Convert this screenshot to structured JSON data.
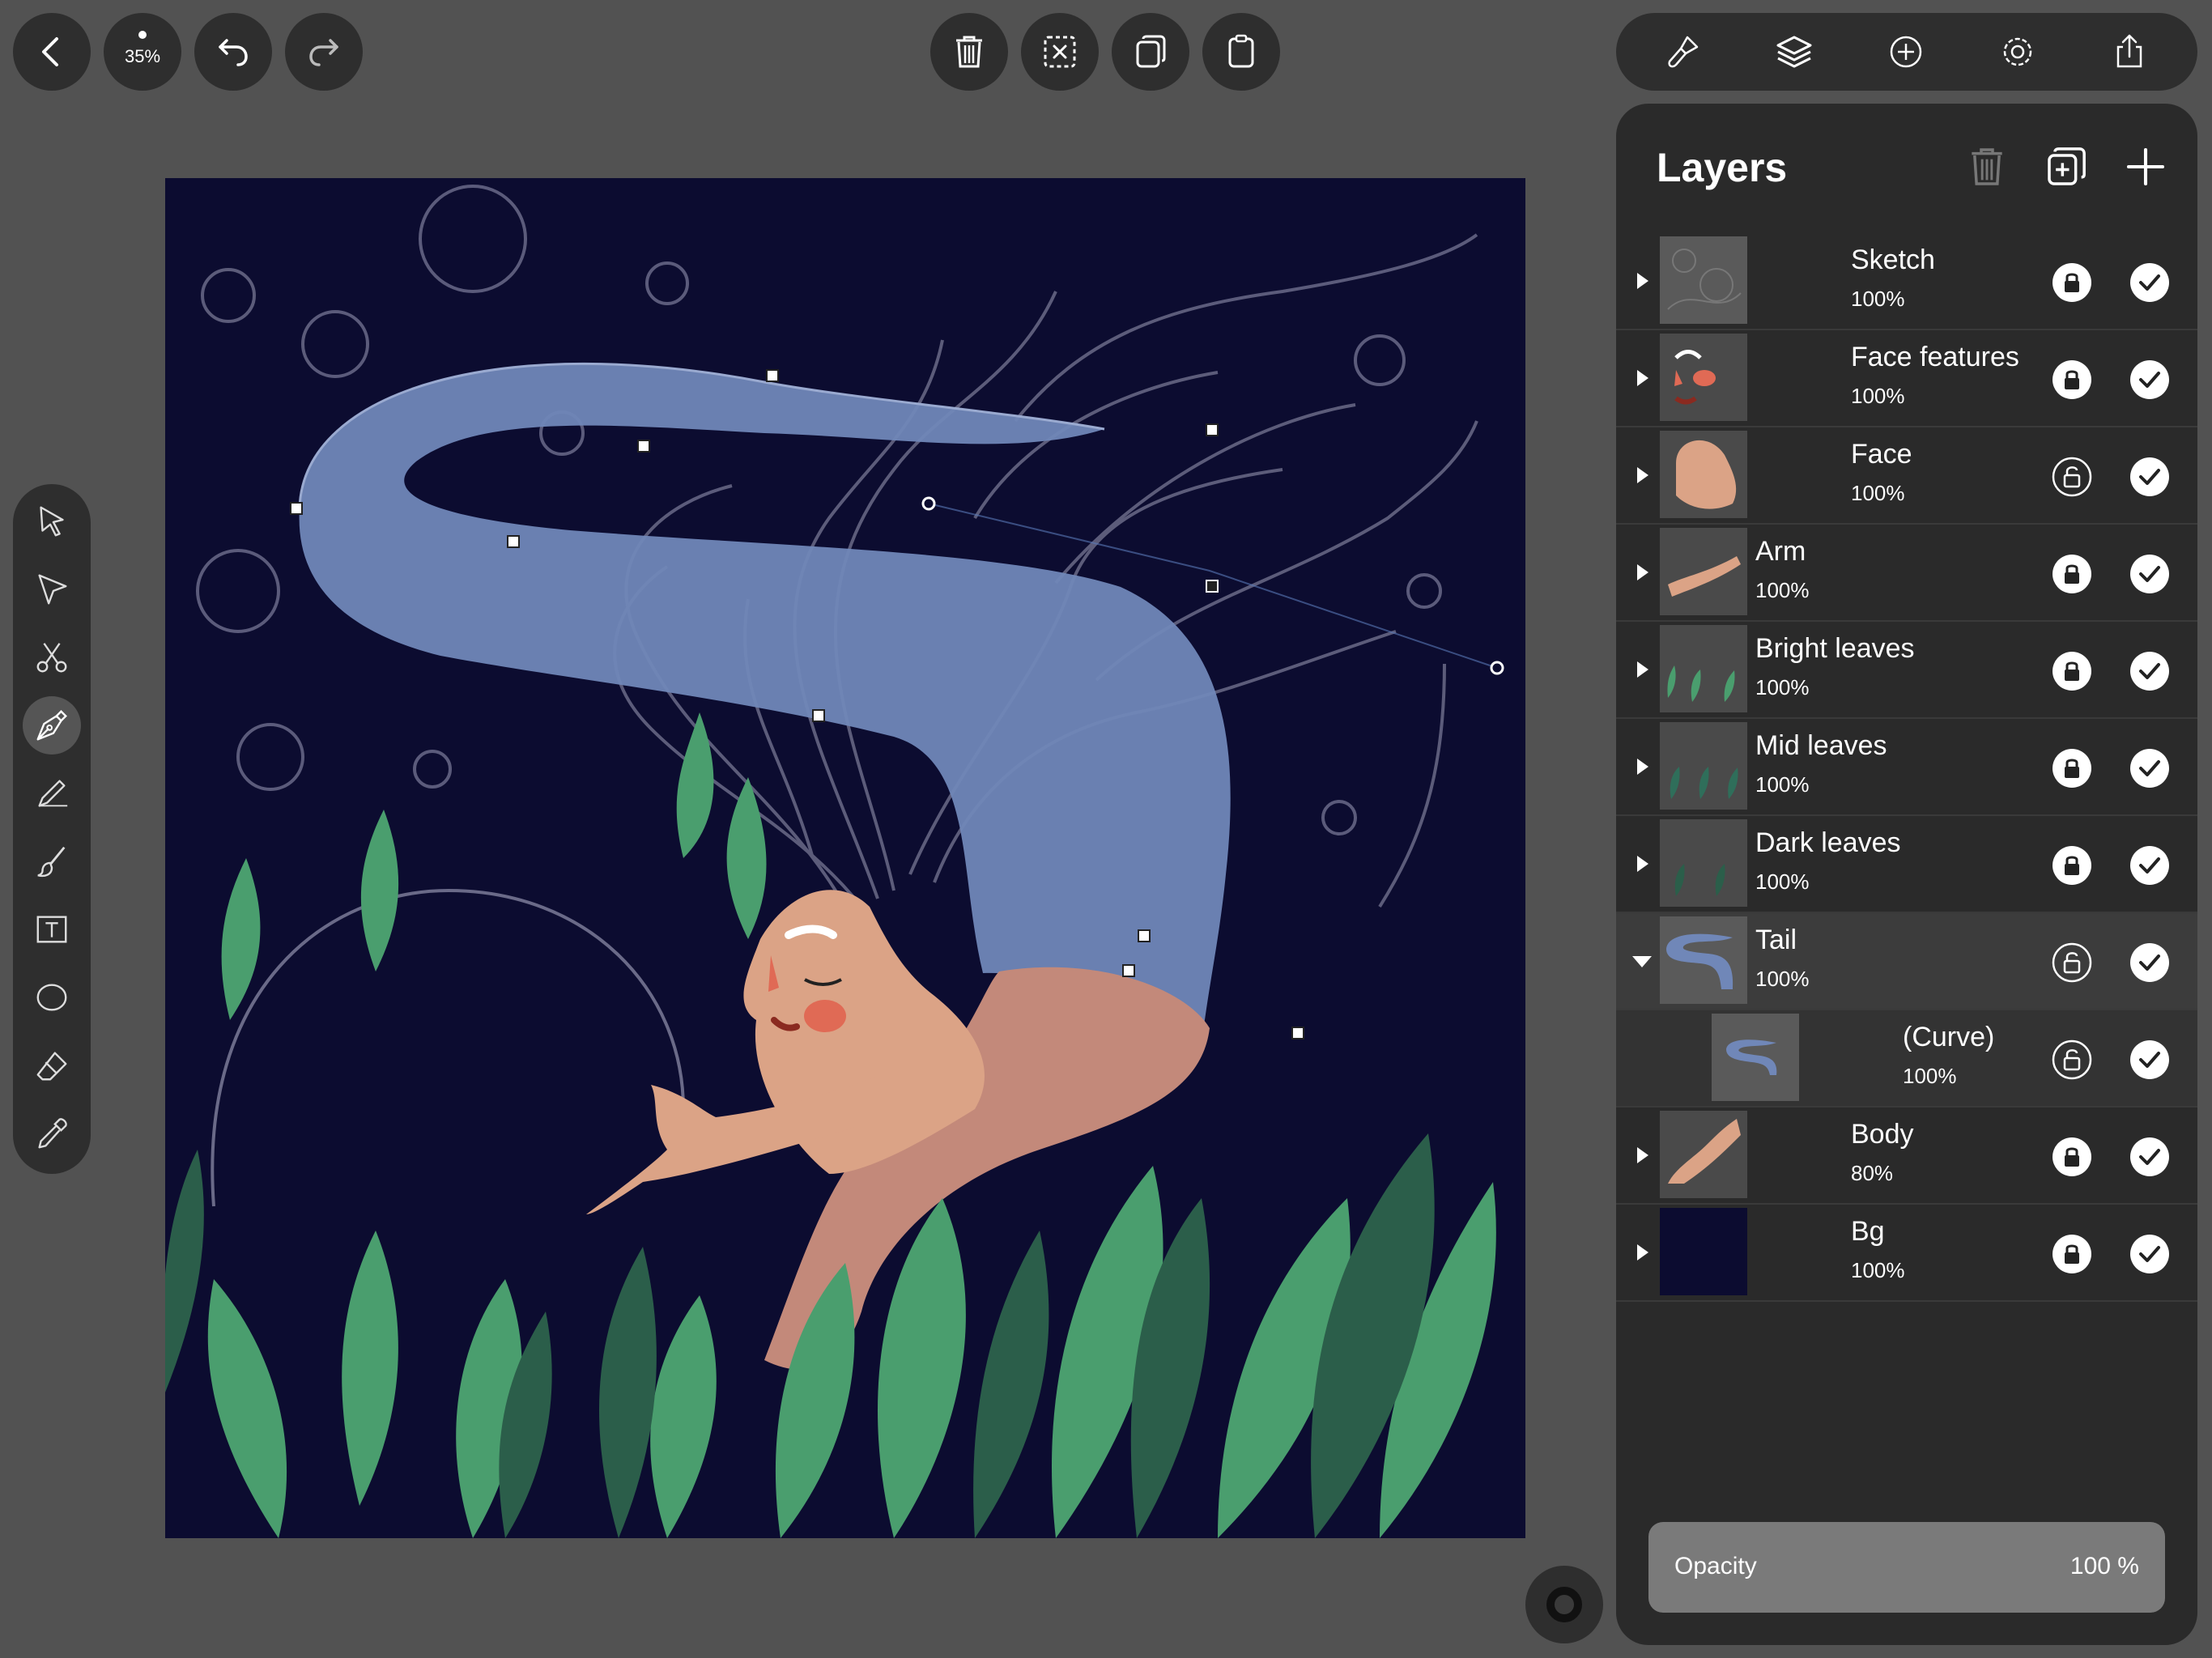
{
  "toolbar": {
    "zoom_label": "35%",
    "left_buttons": [
      "back-icon",
      "zoom-indicator",
      "undo-icon",
      "redo-icon"
    ],
    "center_buttons": [
      "trash-icon",
      "deselect-icon",
      "duplicate-icon",
      "paste-icon"
    ],
    "right_buttons": [
      "style-brush-icon",
      "layers-icon",
      "add-icon",
      "settings-gear-icon",
      "share-icon"
    ]
  },
  "tools": [
    {
      "name": "select-tool",
      "icon": "arrow-pointer-icon"
    },
    {
      "name": "node-tool",
      "icon": "node-pointer-icon"
    },
    {
      "name": "scissors-tool",
      "icon": "scissors-icon"
    },
    {
      "name": "pen-tool",
      "icon": "pen-nib-icon",
      "active": true
    },
    {
      "name": "pencil-tool",
      "icon": "pencil-icon"
    },
    {
      "name": "brush-tool",
      "icon": "brush-icon"
    },
    {
      "name": "text-tool",
      "icon": "text-box-icon"
    },
    {
      "name": "shape-tool",
      "icon": "ellipse-icon"
    },
    {
      "name": "eraser-tool",
      "icon": "eraser-icon"
    },
    {
      "name": "eyedropper-tool",
      "icon": "eyedropper-icon"
    }
  ],
  "layers_panel": {
    "title": "Layers",
    "header_icons": [
      "trash-icon",
      "add-group-icon",
      "plus-icon"
    ],
    "layers": [
      {
        "name": "Sketch",
        "opacity": "100%",
        "locked": true,
        "visible": true,
        "expanded": false
      },
      {
        "name": "Face features",
        "opacity": "100%",
        "locked": true,
        "visible": true,
        "expanded": false
      },
      {
        "name": "Face",
        "opacity": "100%",
        "locked": false,
        "visible": true,
        "expanded": false
      },
      {
        "name": "Arm",
        "opacity": "100%",
        "locked": true,
        "visible": true,
        "expanded": false
      },
      {
        "name": "Bright leaves",
        "opacity": "100%",
        "locked": true,
        "visible": true,
        "expanded": false
      },
      {
        "name": "Mid leaves",
        "opacity": "100%",
        "locked": true,
        "visible": true,
        "expanded": false
      },
      {
        "name": "Dark leaves",
        "opacity": "100%",
        "locked": true,
        "visible": true,
        "expanded": false
      },
      {
        "name": "Tail",
        "opacity": "100%",
        "locked": false,
        "visible": true,
        "expanded": true,
        "selected": true
      },
      {
        "name": "(Curve)",
        "opacity": "100%",
        "locked": false,
        "visible": true,
        "child": true
      },
      {
        "name": "Body",
        "opacity": "80%",
        "locked": true,
        "visible": true,
        "expanded": false
      },
      {
        "name": "Bg",
        "opacity": "100%",
        "locked": true,
        "visible": true,
        "expanded": false
      }
    ],
    "opacity_control": {
      "label": "Opacity",
      "value": "100 %"
    }
  },
  "colors": {
    "canvas_bg": "#0c0c30",
    "tail": "#7087b8",
    "skin": "#dba386",
    "leaf_light": "#4a9e6e",
    "leaf_dark": "#2b5e4a"
  }
}
